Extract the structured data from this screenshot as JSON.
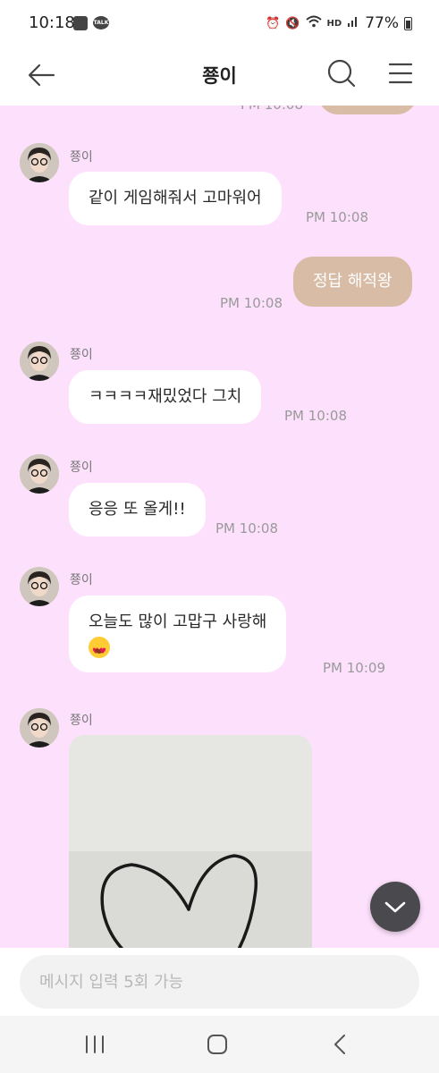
{
  "status_bar": {
    "time": "10:18",
    "talk_icon_text": "TALK",
    "hd_text": "HD",
    "battery": "77%"
  },
  "header": {
    "title": "쭁이"
  },
  "chat": {
    "background_color": "#fde0fc",
    "partial_top_time": "PM 10:08",
    "messages": [
      {
        "sender": "쭁이",
        "text": "같이 게임해줘서 고마워어",
        "time": "PM 10:08"
      },
      {
        "text": "정답 해적왕",
        "time": "PM 10:08"
      },
      {
        "sender": "쭁이",
        "text": "ㅋㅋㅋㅋ재밌었다 그치",
        "time": "PM 10:08"
      },
      {
        "sender": "쭁이",
        "text": "응응 또 올게!!",
        "time": "PM 10:08"
      },
      {
        "sender": "쭁이",
        "text": "오늘도 많이 고맙구 사랑해",
        "emoji": "heart-eyes-emoji",
        "time": "PM 10:09"
      },
      {
        "sender": "쭁이",
        "image": "heart-drawing-photo"
      }
    ]
  },
  "input": {
    "placeholder": "메시지 입력 5회 가능"
  },
  "colors": {
    "incoming_bubble": "#ffffff",
    "outgoing_bubble": "#d8bca6",
    "chat_background": "#fde0fc"
  }
}
